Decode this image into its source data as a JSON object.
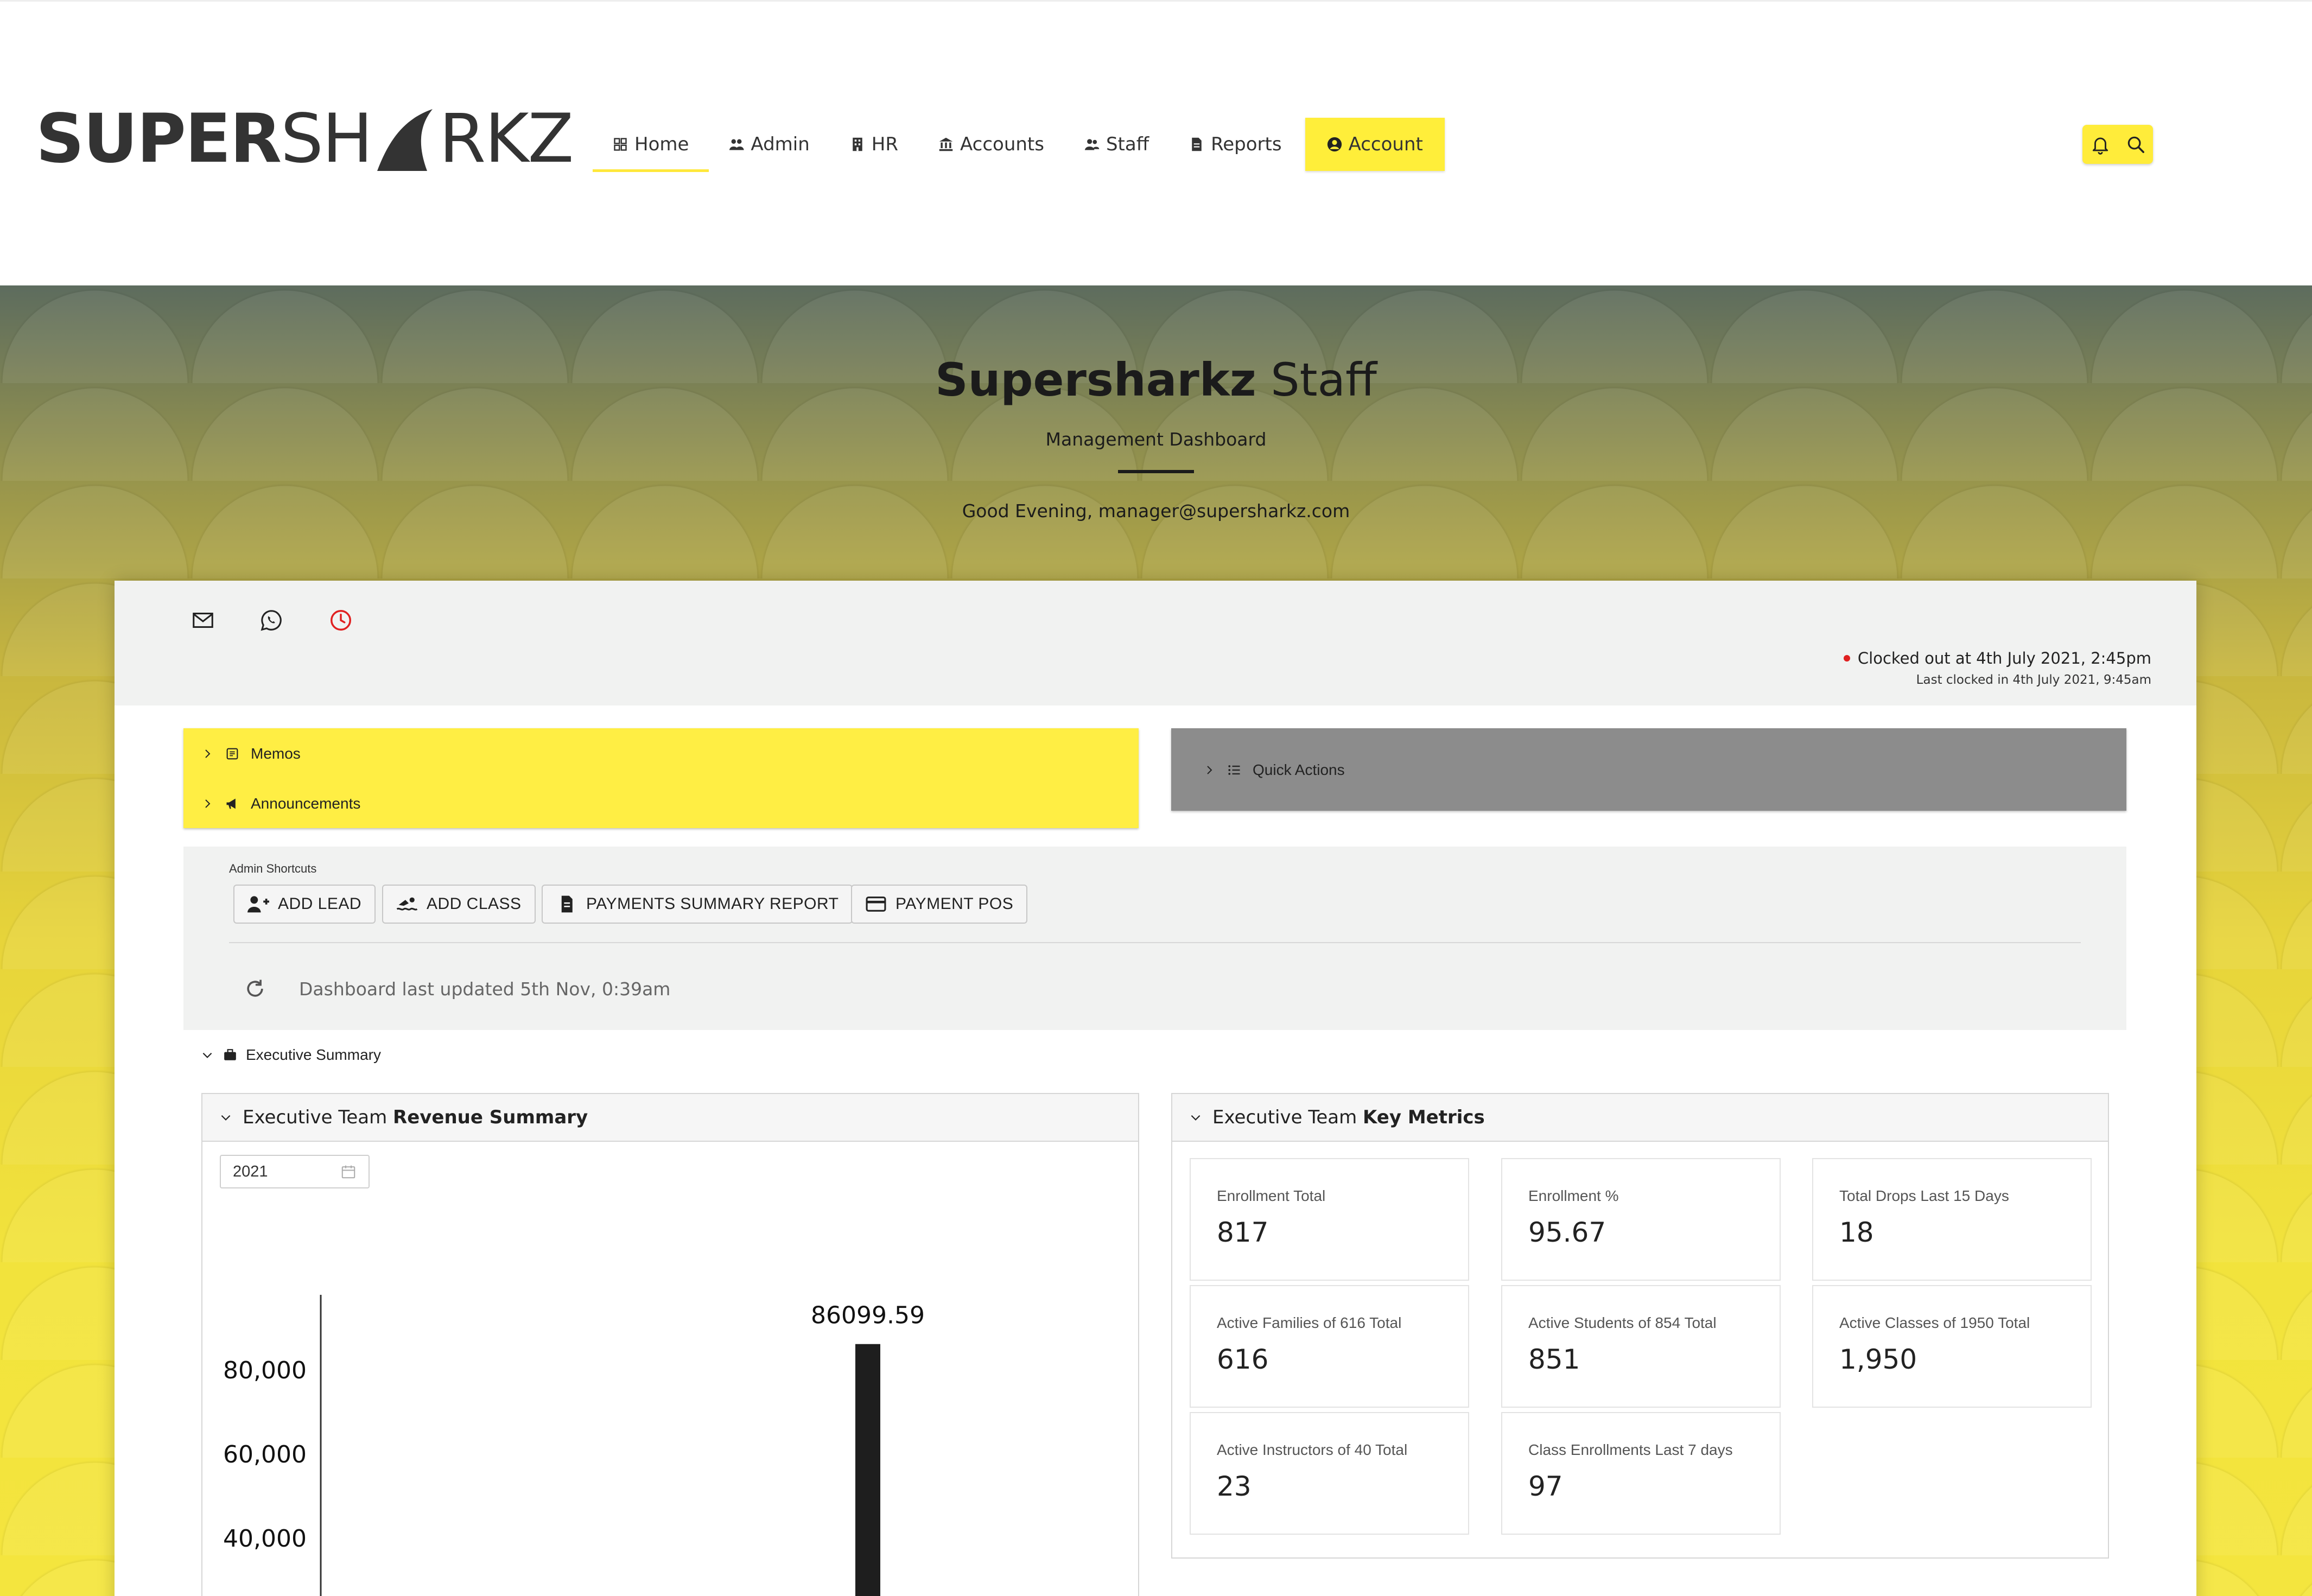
{
  "brand": {
    "part1": "SUPER",
    "part2": "SH",
    "part3": "RKZ"
  },
  "nav": {
    "items": [
      {
        "label": "Home",
        "icon": "grid-icon"
      },
      {
        "label": "Admin",
        "icon": "users-icon"
      },
      {
        "label": "HR",
        "icon": "building-icon"
      },
      {
        "label": "Accounts",
        "icon": "bank-icon"
      },
      {
        "label": "Staff",
        "icon": "user-group-icon"
      },
      {
        "label": "Reports",
        "icon": "file-icon"
      }
    ],
    "account": {
      "label": "Account",
      "icon": "user-circle-icon"
    },
    "active": "Home"
  },
  "hero": {
    "title_bold": "Supersharkz",
    "title_rest": " Staff",
    "subtitle": "Management Dashboard",
    "greeting": "Good Evening, manager@supersharkz.com"
  },
  "clock": {
    "status": "Clocked out at 4th July 2021, 2:45pm",
    "last": "Last clocked in 4th July 2021, 9:45am"
  },
  "panels": {
    "memos": "Memos",
    "announcements": "Announcements",
    "quick_actions": "Quick Actions"
  },
  "shortcuts": {
    "label": "Admin Shortcuts",
    "buttons": [
      "ADD LEAD",
      "ADD CLASS",
      "PAYMENTS SUMMARY REPORT",
      "PAYMENT POS"
    ],
    "updated": "Dashboard last updated 5th Nov, 0:39am"
  },
  "executive": {
    "toggle": "Executive Summary",
    "revenue": {
      "prefix": "Executive Team ",
      "bold": "Revenue Summary",
      "year": "2021"
    },
    "metrics_head": {
      "prefix": "Executive Team ",
      "bold": "Key Metrics"
    },
    "metrics": [
      {
        "title": "Enrollment Total",
        "value": "817"
      },
      {
        "title": "Enrollment %",
        "value": "95.67"
      },
      {
        "title": "Total Drops Last 15 Days",
        "value": "18"
      },
      {
        "title": "Active Families of 616 Total",
        "value": "616"
      },
      {
        "title": "Active Students of 854 Total",
        "value": "851"
      },
      {
        "title": "Active Classes of 1950 Total",
        "value": "1,950"
      },
      {
        "title": "Active Instructors of 40 Total",
        "value": "23"
      },
      {
        "title": "Class Enrollments Last 7 days",
        "value": "97"
      }
    ]
  },
  "chart_data": {
    "type": "bar",
    "ylim": [
      0,
      95000
    ],
    "yticks": [
      "80,000",
      "60,000",
      "40,000"
    ],
    "ytick_values": [
      80000,
      60000,
      40000
    ],
    "values": [
      86099.59
    ],
    "data_labels": [
      "86099.59"
    ],
    "bar_color": "#1e1e1e"
  },
  "colors": {
    "accent": "#ffee3a",
    "panel_gray": "#8c8c8c",
    "alert_red": "#e02020"
  }
}
